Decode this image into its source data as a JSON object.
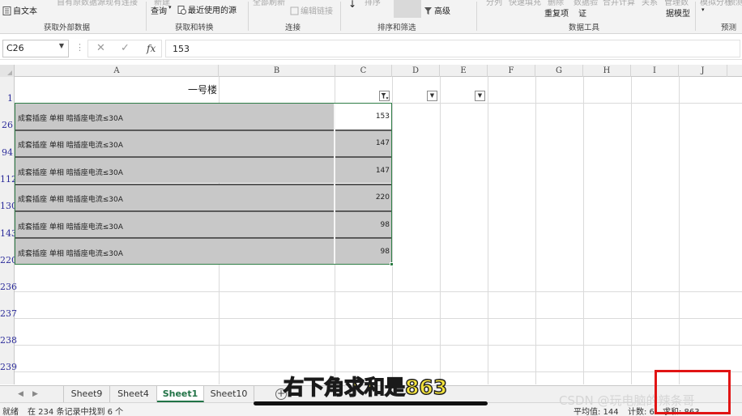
{
  "ribbon": {
    "partial_top": [
      "自有原数据源",
      "现有连接",
      "新建",
      "全部刷新",
      "排序",
      "筛选",
      "分列",
      "快速填充",
      "删除",
      "数据验",
      "合并计算",
      "关系",
      "管理数",
      "模拟分析",
      "预测"
    ],
    "get_external_data": {
      "from_text": "自文本",
      "group_label": "获取外部数据"
    },
    "get_transform": {
      "new_query": "查询",
      "recent_sources": "最近使用的源",
      "group_label": "获取和转换"
    },
    "connections": {
      "edit_links": "编辑链接",
      "group_label": "连接"
    },
    "sort_filter": {
      "advanced": "高级",
      "group_label": "排序和筛选"
    },
    "data_tools": {
      "remove_dup": "重复项",
      "validation": "证",
      "data_model": "据模型",
      "group_label": "数据工具"
    },
    "forecast": {
      "group_label": "预测"
    }
  },
  "formula_bar": {
    "name_box": "C26",
    "formula": "153",
    "cancel_icon": "✕",
    "enter_icon": "✓",
    "fx": "fx"
  },
  "grid": {
    "columns": [
      "A",
      "B",
      "C",
      "D",
      "E",
      "F",
      "G",
      "H",
      "I",
      "J"
    ],
    "rows": [
      "1",
      "26",
      "94",
      "112",
      "130",
      "143",
      "220",
      "236",
      "237",
      "238",
      "239"
    ],
    "title": "一号楼",
    "items": [
      {
        "label": "成套插座 单相 暗插座电流≤30A",
        "value": "153"
      },
      {
        "label": "成套插座 单相 暗插座电流≤30A",
        "value": "147"
      },
      {
        "label": "成套插座 单相 暗插座电流≤30A",
        "value": "147"
      },
      {
        "label": "成套插座 单相 暗插座电流≤30A",
        "value": "220"
      },
      {
        "label": "成套插座 单相 暗插座电流≤30A",
        "value": "98"
      },
      {
        "label": "成套插座 单相 暗插座电流≤30A",
        "value": "98"
      }
    ]
  },
  "sheets": [
    "Sheet9",
    "Sheet4",
    "Sheet1",
    "Sheet10"
  ],
  "active_sheet": "Sheet1",
  "status": {
    "ready": "就绪",
    "found": "在 234 条记录中找到 6 个",
    "average": "平均值: 144",
    "count": "计数: 6",
    "sum": "求和: 863"
  },
  "overlay": {
    "subtitle": "右下角求和是863",
    "watermark": "CSDN @玩电脑的辣条哥"
  },
  "colors": {
    "excel_green": "#217346",
    "selection_green": "#2e7d46",
    "highlight_grey": "#c8c8c8",
    "annotation_red": "#e11414",
    "subtitle_yellow": "#f2e23c"
  }
}
